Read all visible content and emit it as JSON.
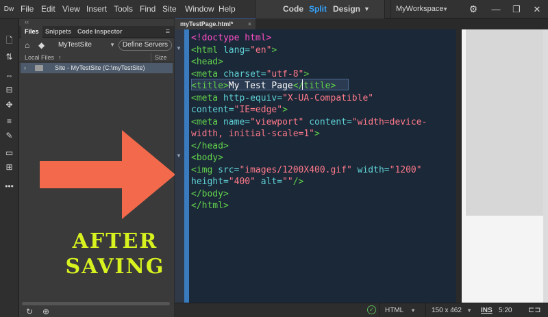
{
  "app": {
    "logo": "Dw",
    "menu": [
      "File",
      "Edit",
      "View",
      "Insert",
      "Tools",
      "Find",
      "Site",
      "Window",
      "Help"
    ],
    "modes": {
      "code": "Code",
      "split": "Split",
      "design": "Design"
    },
    "workspace": "MyWorkspace"
  },
  "files_panel": {
    "tabs": [
      "Files",
      "Snippets",
      "Code Inspector"
    ],
    "site_name": "MyTestSite",
    "define_servers": "Define Servers",
    "col_local": "Local Files",
    "col_size": "Size",
    "root_item": "Site - MyTestSite (C:\\myTestSite)"
  },
  "annotation": {
    "line1": "AFTER",
    "line2": "SAVING",
    "arrow_color": "#f26a4b",
    "text_color": "#d7f21e"
  },
  "document": {
    "tab": "myTestPage.html*",
    "code_lines": [
      [
        {
          "c": "doctype",
          "t": "<!doctype html>"
        }
      ],
      [
        {
          "c": "tag",
          "t": "<html "
        },
        {
          "c": "attr",
          "t": "lang="
        },
        {
          "c": "val",
          "t": "\"en\""
        },
        {
          "c": "tag",
          "t": ">"
        }
      ],
      [
        {
          "c": "tag",
          "t": "<head>"
        }
      ],
      [
        {
          "c": "tag",
          "t": "<meta "
        },
        {
          "c": "attr",
          "t": "charset="
        },
        {
          "c": "val",
          "t": "\"utf-8\""
        },
        {
          "c": "tag",
          "t": ">"
        }
      ],
      [
        {
          "c": "tag",
          "t": "<title>"
        },
        {
          "c": "text",
          "t": "My Test Page"
        },
        {
          "c": "tag",
          "t": "</title>"
        }
      ],
      [
        {
          "c": "tag",
          "t": "<meta "
        },
        {
          "c": "attr",
          "t": "http-equiv="
        },
        {
          "c": "val",
          "t": "\"X-UA-Compatible\""
        }
      ],
      [
        {
          "c": "attr",
          "t": "content="
        },
        {
          "c": "val",
          "t": "\"IE=edge\""
        },
        {
          "c": "tag",
          "t": ">"
        }
      ],
      [
        {
          "c": "tag",
          "t": "<meta "
        },
        {
          "c": "attr",
          "t": "name="
        },
        {
          "c": "val",
          "t": "\"viewport\""
        },
        {
          "c": "attr",
          "t": " content="
        },
        {
          "c": "val",
          "t": "\"width=device-"
        }
      ],
      [
        {
          "c": "val",
          "t": "width, initial-scale=1\""
        },
        {
          "c": "tag",
          "t": ">"
        }
      ],
      [
        {
          "c": "tag",
          "t": "</head>"
        }
      ],
      [
        {
          "c": "tag",
          "t": "<body>"
        }
      ],
      [
        {
          "c": "tag",
          "t": "<img "
        },
        {
          "c": "attr",
          "t": "src="
        },
        {
          "c": "val",
          "t": "\"images/1200X400.gif\""
        },
        {
          "c": "attr",
          "t": " width="
        },
        {
          "c": "val",
          "t": "\"1200\""
        }
      ],
      [
        {
          "c": "attr",
          "t": "height="
        },
        {
          "c": "val",
          "t": "\"400\""
        },
        {
          "c": "attr",
          "t": " alt="
        },
        {
          "c": "val",
          "t": "\"\""
        },
        {
          "c": "tag",
          "t": "/>"
        }
      ],
      [
        {
          "c": "tag",
          "t": "</body>"
        }
      ],
      [
        {
          "c": "tag",
          "t": "</html>"
        }
      ]
    ]
  },
  "status": {
    "language": "HTML",
    "dimensions": "150 x 462",
    "mode": "INS",
    "position": "5:20"
  }
}
